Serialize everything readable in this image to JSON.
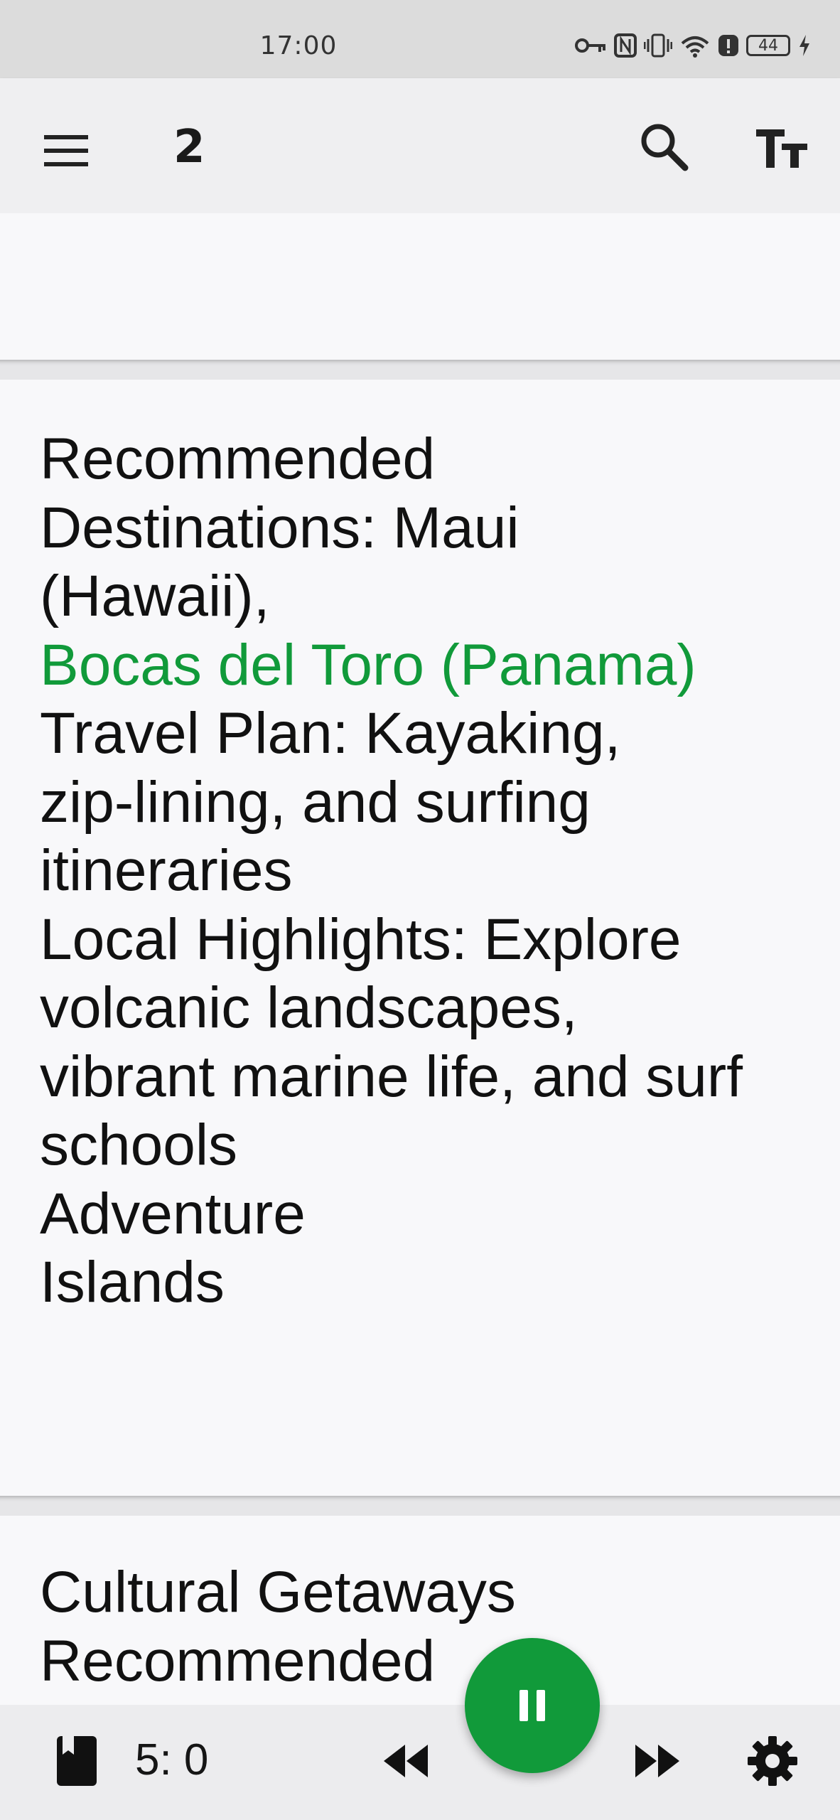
{
  "status_bar": {
    "time": "17:00",
    "battery": "44"
  },
  "app_bar": {
    "page_number": "2",
    "icons": [
      "menu-icon",
      "search-icon",
      "text-size-icon"
    ]
  },
  "content": {
    "card_main_lines": [
      "Recommended",
      "Destinations: Maui",
      "(Hawaii),",
      "Bocas del Toro (Panama)",
      "Travel Plan: Kayaking,",
      "zip-lining, and surfing",
      "itineraries",
      "Local Highlights: Explore",
      "volcanic landscapes,",
      "vibrant marine life, and surf",
      "schools",
      "Adventure",
      "Islands"
    ],
    "card_next_lines": [
      "Cultural Getaways",
      "Recommended"
    ],
    "highlight_color": "#119a3a"
  },
  "player": {
    "position": "5: 0",
    "icons": [
      "book-icon",
      "rewind-icon",
      "pause-icon",
      "fast-forward-icon",
      "settings-icon"
    ],
    "accent": "#119a3a"
  }
}
